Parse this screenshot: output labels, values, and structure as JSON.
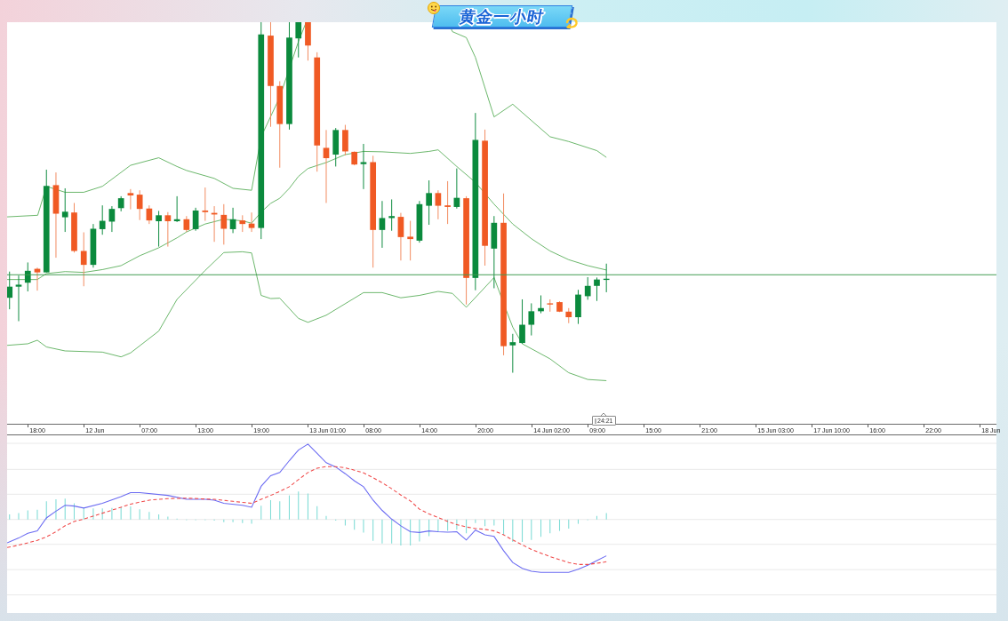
{
  "banner": {
    "title": "黄金一小时"
  },
  "time_axis": {
    "labels": [
      "18:00",
      "12 Jun",
      "07:00",
      "13:00",
      "19:00",
      "13 Jun 01:00",
      "08:00",
      "14:00",
      "20:00",
      "14 Jun 02:00",
      "09:00",
      "15:00",
      "21:00",
      "15 Jun 03:00",
      "17 Jun 10:00",
      "16:00",
      "22:00",
      "18 Jun"
    ],
    "countdown": "24:21"
  }
}
